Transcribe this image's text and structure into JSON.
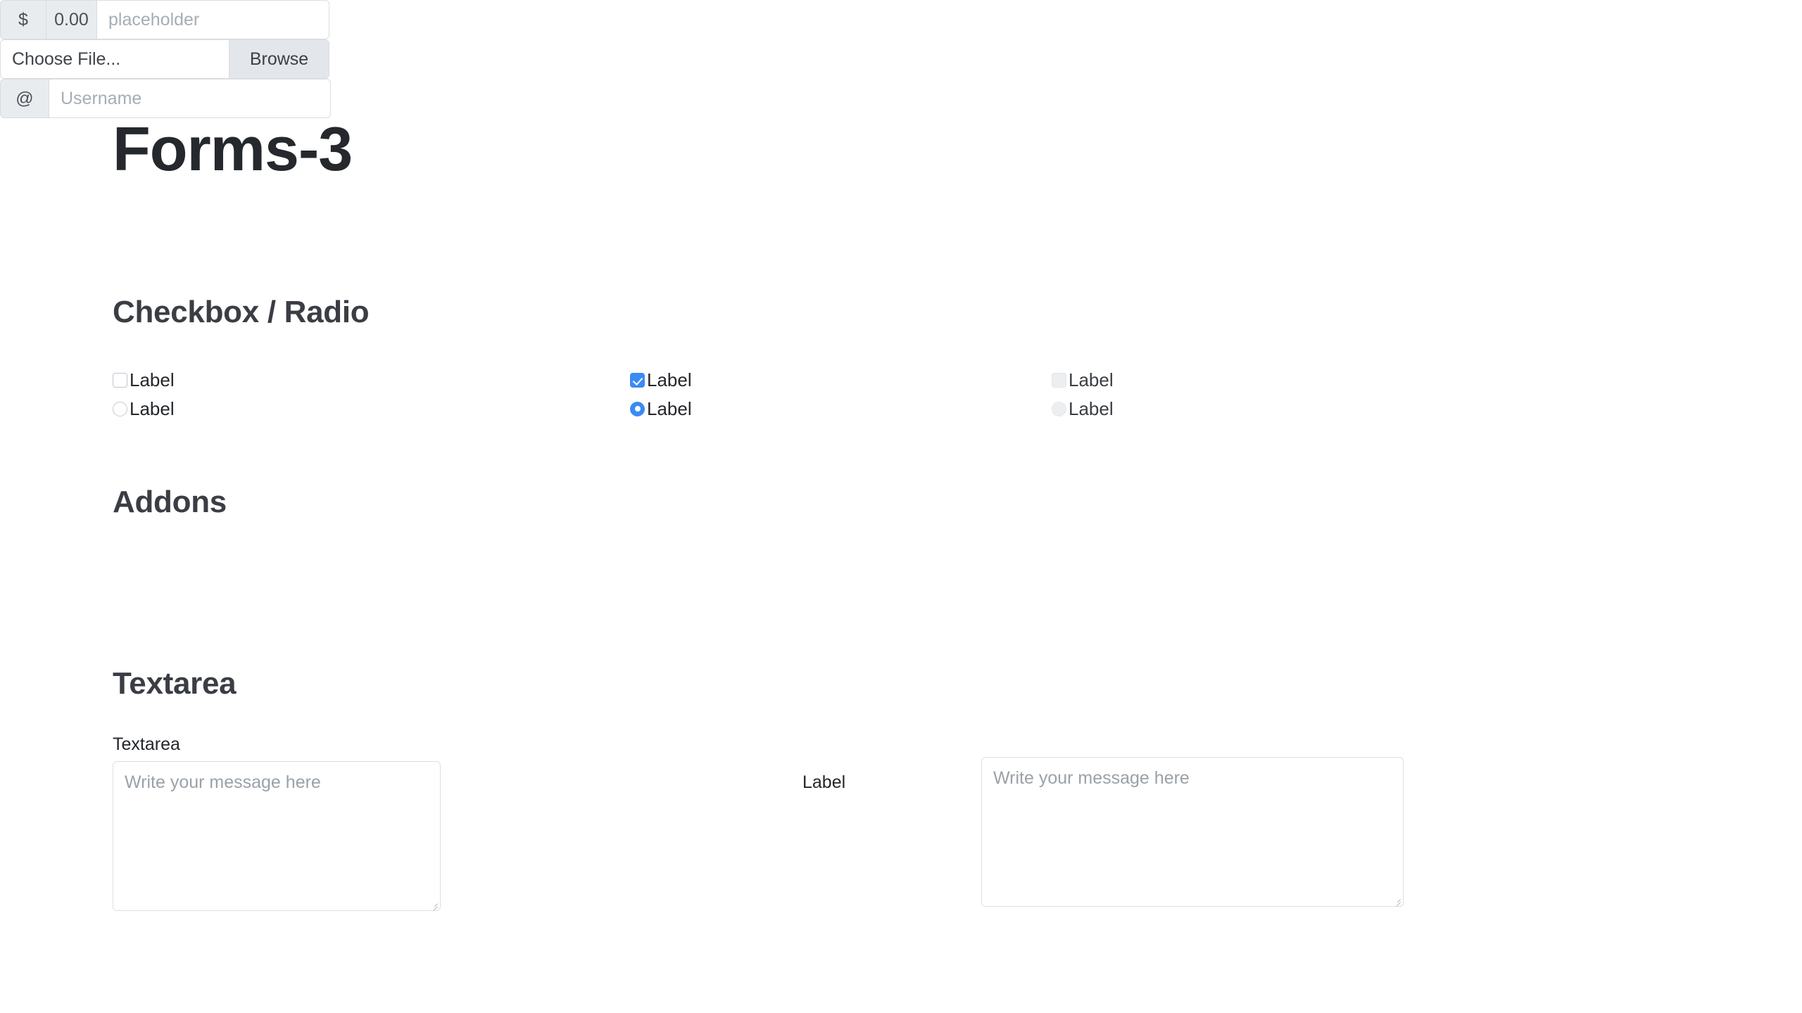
{
  "page": {
    "title": "Forms-3",
    "background_color": "#ffffff",
    "accent_color": "#3b8bf4",
    "text_color": "#23262a"
  },
  "sections": {
    "checkbox_radio": {
      "heading": "Checkbox / Radio",
      "checkboxes": [
        {
          "label": "Label",
          "checked": false,
          "disabled": false
        },
        {
          "label": "Label",
          "checked": true,
          "disabled": false
        },
        {
          "label": "Label",
          "checked": false,
          "disabled": true
        }
      ],
      "radios": [
        {
          "label": "Label",
          "selected": false,
          "disabled": false
        },
        {
          "label": "Label",
          "selected": true,
          "disabled": false
        },
        {
          "label": "Label",
          "selected": false,
          "disabled": true
        }
      ]
    },
    "addons": {
      "heading": "Addons",
      "groups": [
        {
          "name": "price-input-group",
          "prefix_addons": [
            "$",
            "0.00"
          ],
          "input_placeholder": "placeholder"
        },
        {
          "name": "file-input-group",
          "input_value": "Choose File...",
          "button_label": "Browse"
        },
        {
          "name": "username-input-group",
          "prefix_addons": [
            "@"
          ],
          "input_placeholder": "Username"
        }
      ]
    },
    "textarea": {
      "heading": "Textarea",
      "left": {
        "label": "Textarea",
        "placeholder": "Write your message here"
      },
      "right": {
        "label": "Label",
        "placeholder": "Write your message here"
      }
    }
  }
}
